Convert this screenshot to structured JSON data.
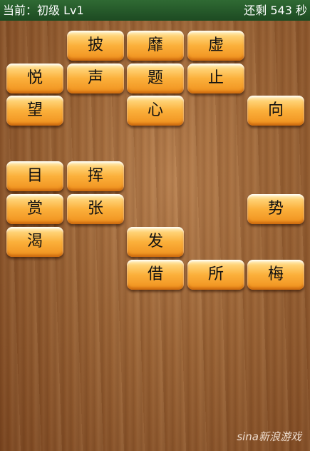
{
  "header": {
    "level": "当前：初级 Lv1",
    "timer": "还剩 543 秒"
  },
  "tiles": [
    {
      "char": "披"
    },
    {
      "char": "靡"
    },
    {
      "char": "虚"
    },
    {
      "char": "悦"
    },
    {
      "char": "声"
    },
    {
      "char": "题"
    },
    {
      "char": "止"
    },
    {
      "char": "望"
    },
    {
      "char": "心"
    },
    {
      "char": "向"
    },
    {
      "char": "目"
    },
    {
      "char": "挥"
    },
    {
      "char": "赏"
    },
    {
      "char": "张"
    },
    {
      "char": "势"
    },
    {
      "char": "渴"
    },
    {
      "char": "发"
    },
    {
      "char": "借"
    },
    {
      "char": "所"
    },
    {
      "char": "梅"
    }
  ],
  "watermark": "sina新浪游戏"
}
